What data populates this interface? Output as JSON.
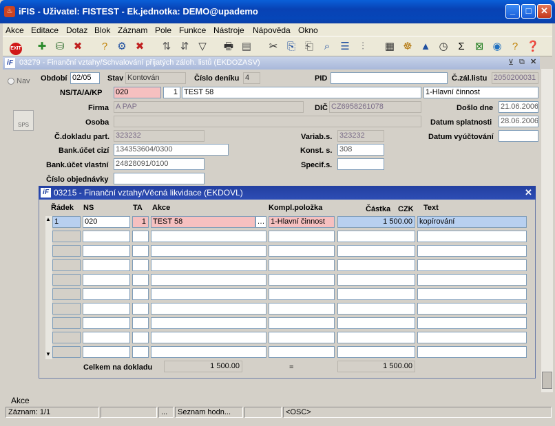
{
  "window": {
    "title": "iFIS - Uživatel: FISTEST - Ek.jednotka: DEMO@upademo"
  },
  "menu": [
    "Akce",
    "Editace",
    "Dotaz",
    "Blok",
    "Záznam",
    "Pole",
    "Funkce",
    "Nástroje",
    "Nápověda",
    "Okno"
  ],
  "form": {
    "title": "03279 - Finanční vztahy/Schvalování přijatých záloh. listů (EKDOZASV)",
    "nav_label": "Nav",
    "sps_label": "SPS",
    "labels": {
      "obdobi": "Období",
      "stav": "Stav",
      "cislo_deniku": "Číslo deníku",
      "pid": "PID",
      "c_zal_listu": "Č.zál.listu",
      "ns": "NS/TA/A/KP",
      "firma": "Firma",
      "dic": "DIČ",
      "doslo_dne": "Došlo dne",
      "osoba": "Osoba",
      "datum_splatnosti": "Datum splatnosti",
      "c_dokladu": "Č.dokladu part.",
      "varias": "Variab.s.",
      "datum_vyuctovani": "Datum vyúčtování",
      "bank_cizi": "Bank.účet cizí",
      "konst": "Konst. s.",
      "bank_vlastni": "Bank.účet vlastní",
      "specif": "Specif.s.",
      "cislo_obj": "Číslo objednávky"
    },
    "values": {
      "obdobi": "02/05",
      "stav": "Kontován",
      "cislo_deniku": "4",
      "pid": "",
      "c_zal_listu": "2050200031",
      "ns": "020",
      "ta": "1",
      "akce": "TEST 58",
      "kp": "1-Hlavní činnost",
      "firma": "A PAP",
      "dic": "CZ6958261078",
      "doslo_dne": "21.06.2006",
      "osoba": "",
      "datum_splatnosti": "28.06.2006",
      "c_dokladu": "323232",
      "varias": "323232",
      "datum_vyuctovani": "",
      "bank_cizi": "134353604/0300",
      "konst": "308",
      "bank_vlastni": "24828091/0100",
      "specif": "",
      "cislo_obj": ""
    }
  },
  "subform": {
    "title": "03215 - Finanční vztahy/Věcná likvidace (EKDOVL)",
    "headers": {
      "radek": "Řádek",
      "ns": "NS",
      "ta": "TA",
      "akce": "Akce",
      "kompl": "Kompl.položka",
      "castka": "Částka",
      "czk": "CZK",
      "text": "Text"
    },
    "row1": {
      "radek": "1",
      "ns": "020",
      "ta": "1",
      "akce": "TEST 58",
      "kompl": "1-Hlavní činnost",
      "castka": "1 500.00",
      "text": "kopírování"
    },
    "total_label": "Celkem na dokladu",
    "total1": "1 500.00",
    "eq": "=",
    "total2": "1 500.00"
  },
  "status": {
    "akce": "Akce",
    "zaznam": "Záznam: 1/1",
    "dots": "...",
    "seznam": "Seznam hodn...",
    "osc": "<OSC>"
  }
}
